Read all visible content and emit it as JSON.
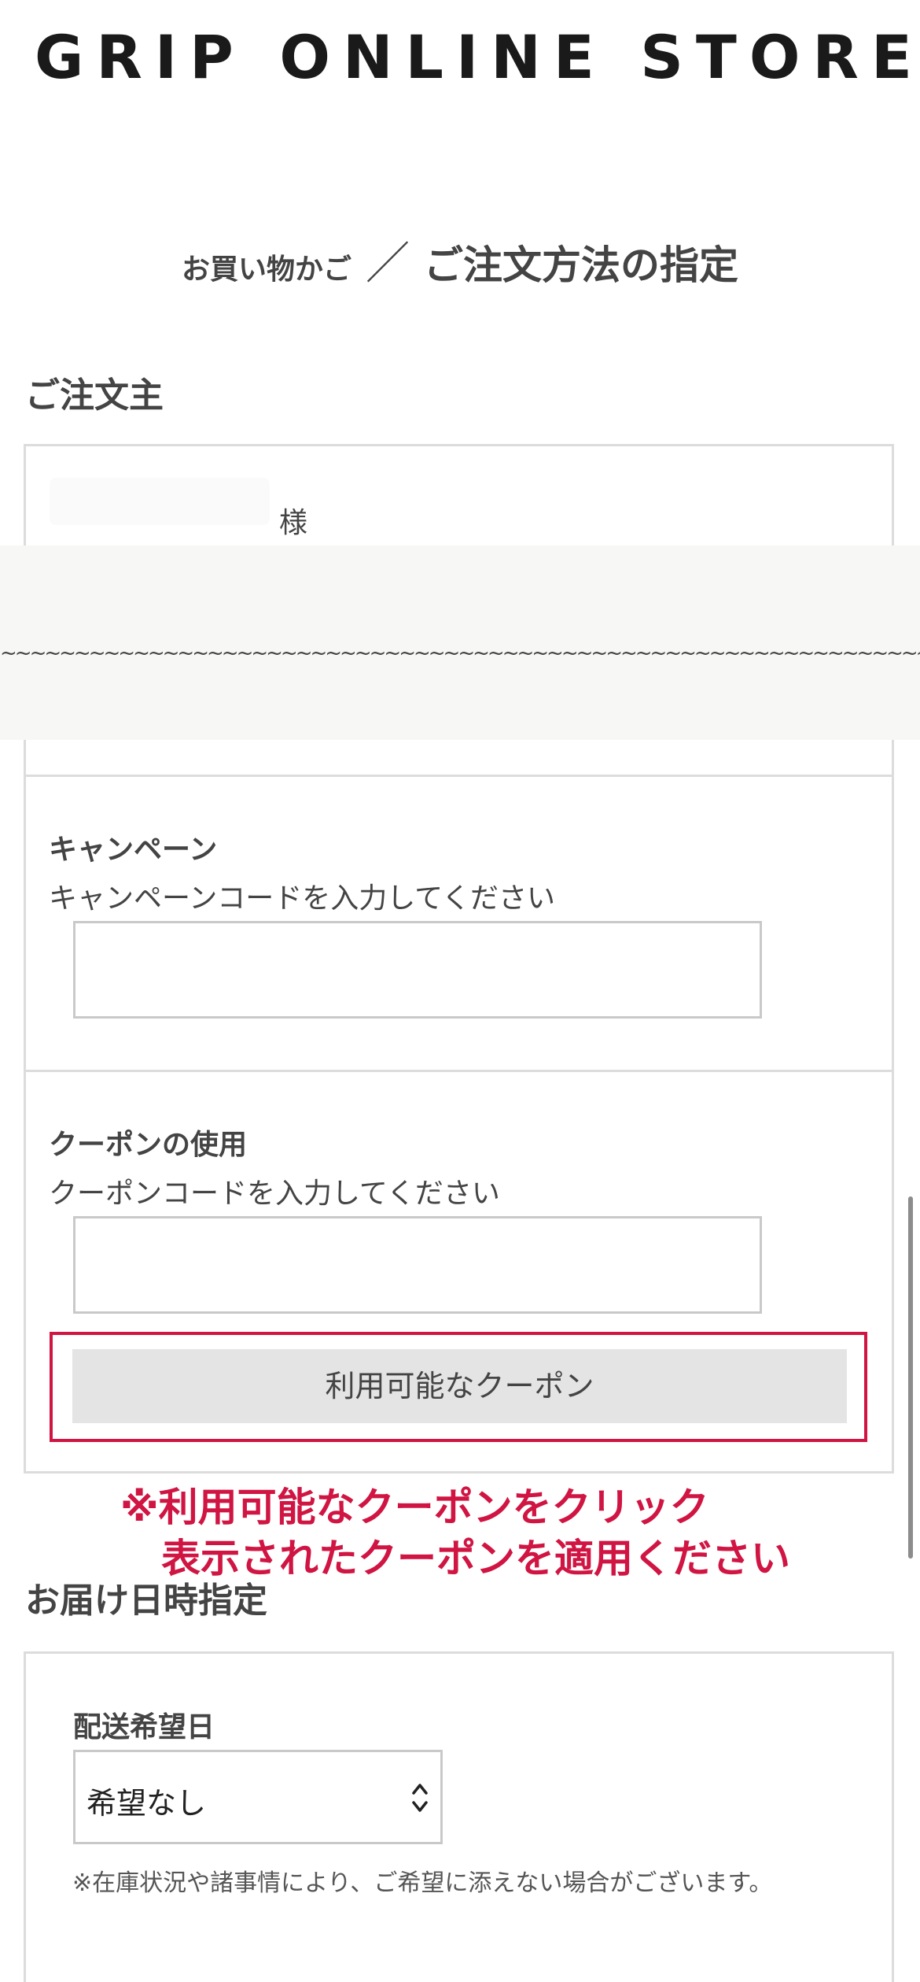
{
  "header": {
    "logo_text": "GRIP ONLINE STORE"
  },
  "breadcrumb": {
    "previous": "お買い物かご",
    "separator": "／",
    "current": "ご注文方法の指定"
  },
  "orderer": {
    "section_title": "ご注文主",
    "honorific": "様"
  },
  "overlay": {
    "text": "~~~~~~~~~~~~~~~~~~~~~~~~~~~~~~~~~~~~~~~~~~~~~~~~~~~~~~~~~~~~~~~~~~~~~~~~~~~~~~~~~~~~~~~~~~~~~~~~~~~~"
  },
  "campaign": {
    "label": "キャンペーン",
    "description": "キャンペーンコードを入力してください",
    "value": ""
  },
  "coupon": {
    "label": "クーポンの使用",
    "description": "クーポンコードを入力してください",
    "value": "",
    "button_label": "利用可能なクーポン"
  },
  "notice": {
    "line1": "※利用可能なクーポンをクリック",
    "line2": "表示されたクーポンを適用ください"
  },
  "delivery": {
    "section_title": "お届け日時指定",
    "date_label": "配送希望日",
    "date_selected": "希望なし",
    "footnote": "※在庫状況や諸事情により、ご希望に添えない場合がございます。"
  },
  "colors": {
    "accent_red": "#d01543",
    "button_gray": "#e4e4e4",
    "border_gray": "#dcdcdc"
  }
}
